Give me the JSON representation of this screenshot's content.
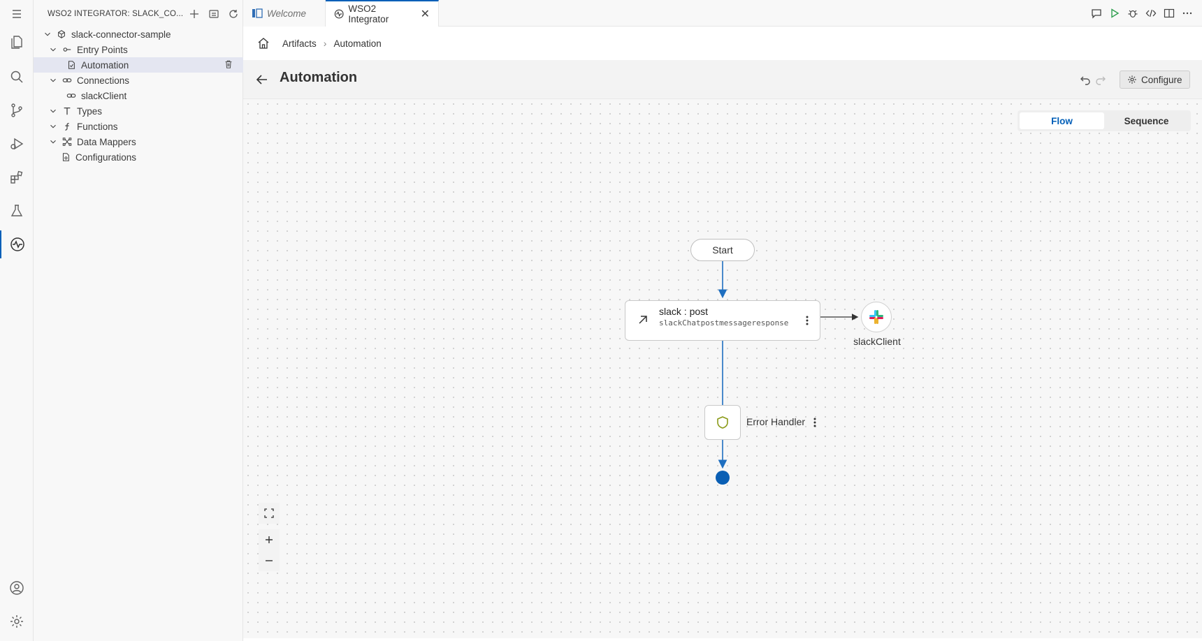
{
  "sidebar": {
    "title": "WSO2 INTEGRATOR: SLACK_CO...",
    "tree": [
      {
        "label": "slack-connector-sample"
      },
      {
        "label": "Entry Points"
      },
      {
        "label": "Automation"
      },
      {
        "label": "Connections"
      },
      {
        "label": "slackClient"
      },
      {
        "label": "Types"
      },
      {
        "label": "Functions"
      },
      {
        "label": "Data Mappers"
      },
      {
        "label": "Configurations"
      }
    ]
  },
  "tabs": [
    {
      "label": "Welcome",
      "state": "inactive"
    },
    {
      "label": "WSO2 Integrator",
      "state": "active"
    }
  ],
  "breadcrumb": {
    "items": [
      "Artifacts",
      "Automation"
    ]
  },
  "page": {
    "title": "Automation",
    "configure_label": "Configure"
  },
  "view_toggle": {
    "options": [
      "Flow",
      "Sequence"
    ],
    "selected": "Flow"
  },
  "flow": {
    "start_label": "Start",
    "action_name": "slack : post",
    "action_sub": "slackChatpostmessageresponse",
    "connection_label": "slackClient",
    "error_label": "Error Handler"
  },
  "colors": {
    "accent": "#005fb8",
    "edge": "#1f6fc0",
    "error_icon": "#8a9a18"
  }
}
